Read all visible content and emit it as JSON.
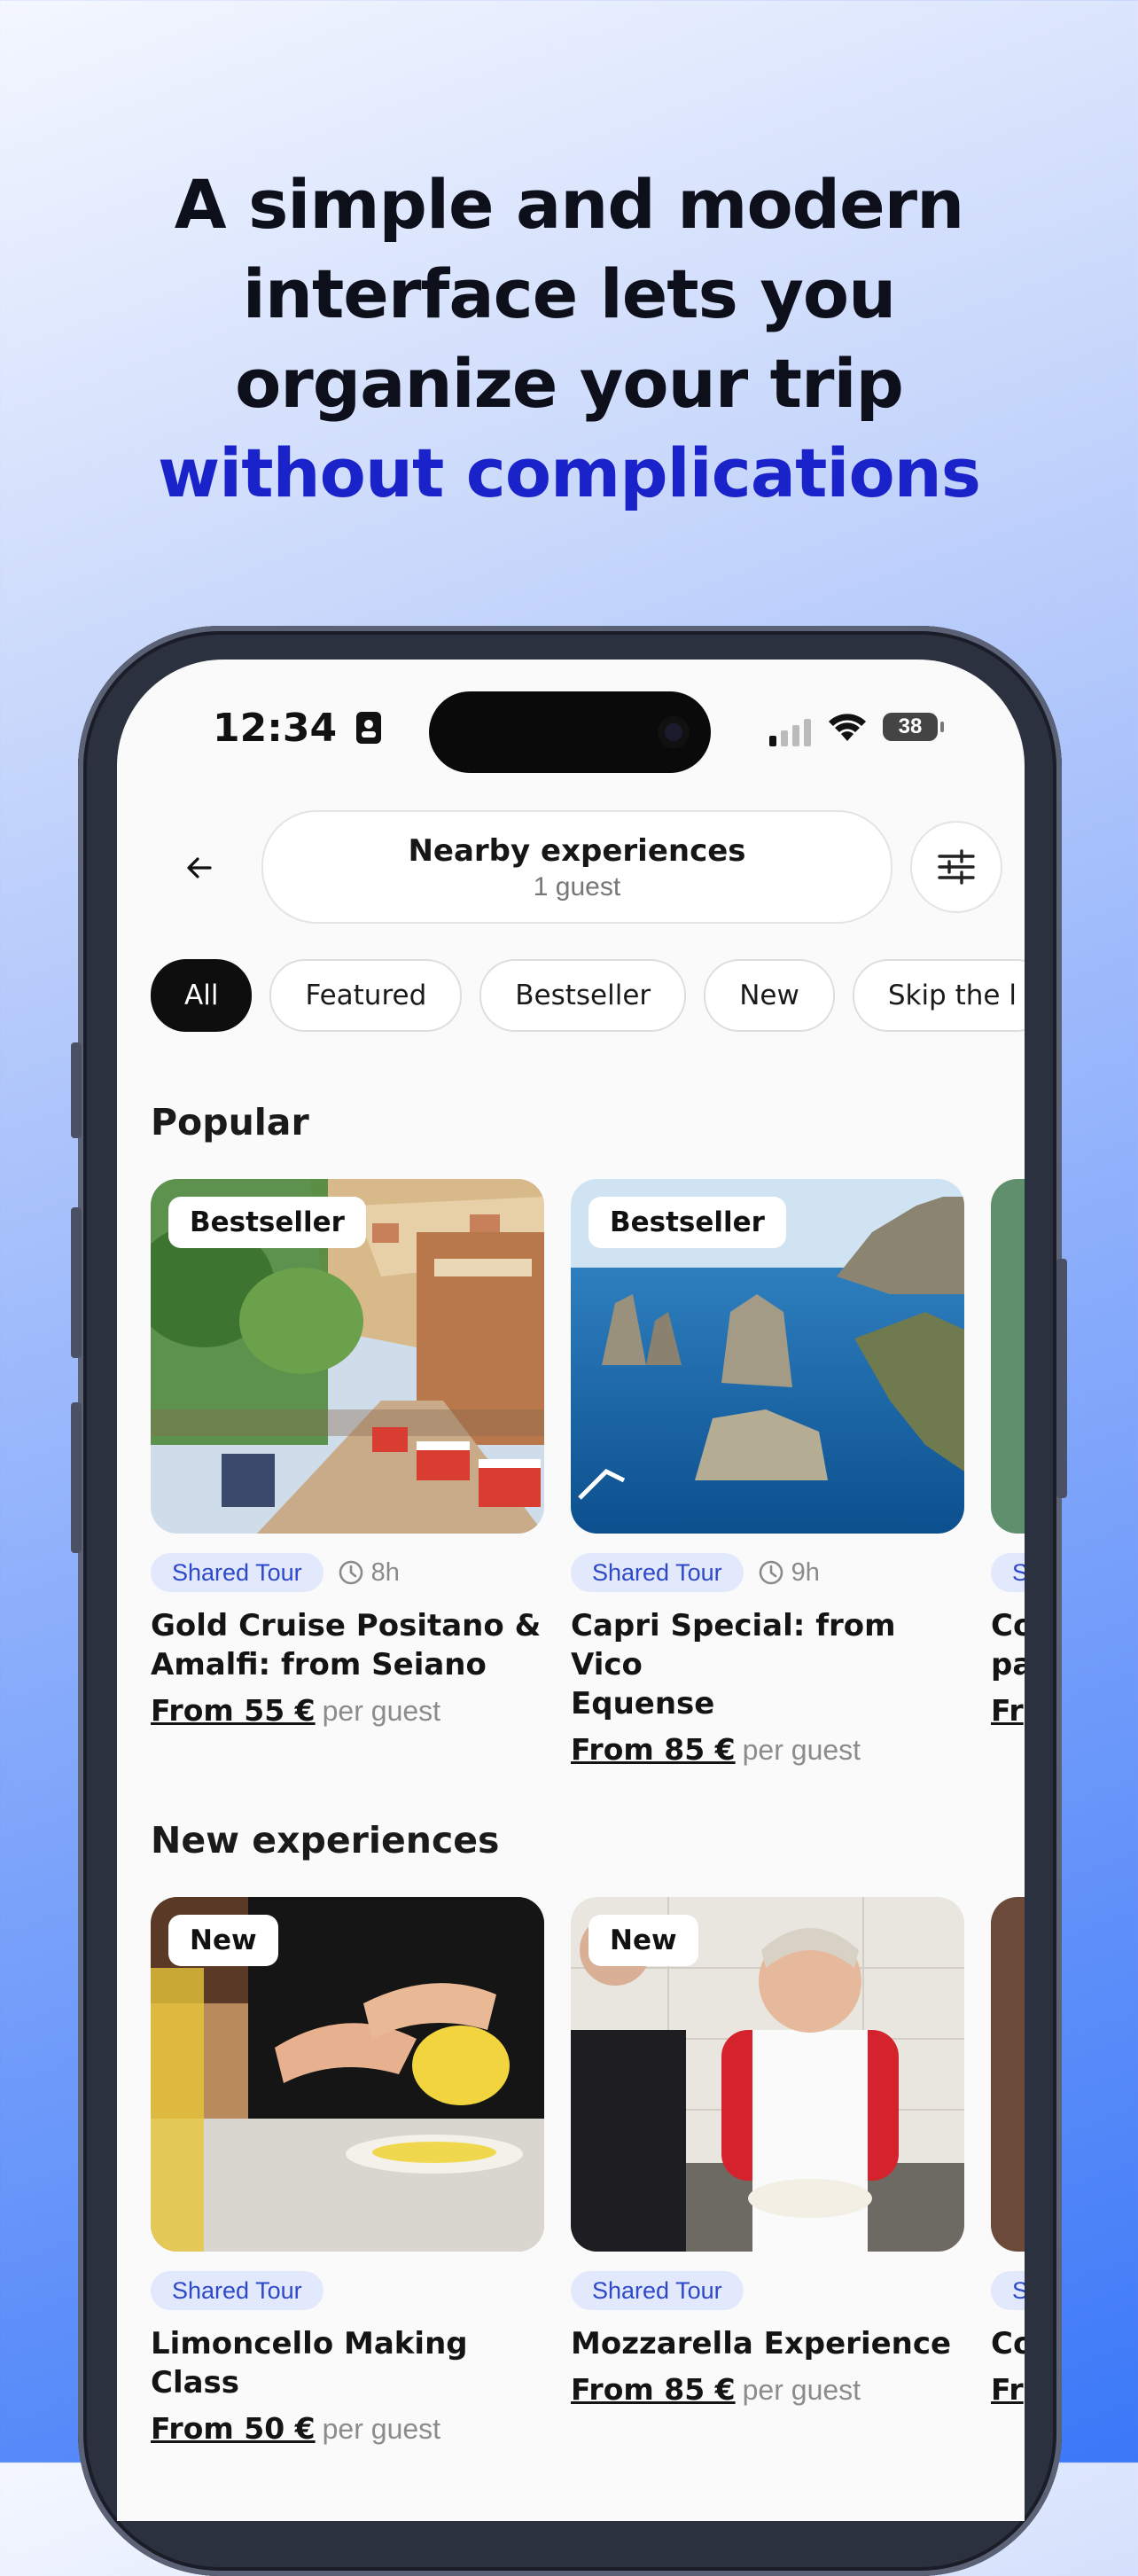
{
  "headline": {
    "line1": "A simple and modern",
    "line2": "interface lets you",
    "line3": "organize your trip",
    "accent": "without complications",
    "accent_color": "#1a23c9"
  },
  "status_bar": {
    "time": "12:34",
    "battery": "38"
  },
  "header": {
    "search_title": "Nearby experiences",
    "search_subtitle": "1 guest"
  },
  "chips": [
    {
      "label": "All",
      "active": true
    },
    {
      "label": "Featured",
      "active": false
    },
    {
      "label": "Bestseller",
      "active": false
    },
    {
      "label": "New",
      "active": false
    },
    {
      "label": "Skip the l",
      "active": false
    }
  ],
  "sections": {
    "popular": {
      "title": "Popular",
      "cards": [
        {
          "badge": "Bestseller",
          "tag": "Shared Tour",
          "duration": "8h",
          "title_line1": "Gold Cruise Positano &",
          "title_line2": "Amalfi: from Seiano",
          "price": "From 55 €",
          "per": "per guest"
        },
        {
          "badge": "Bestseller",
          "tag": "Shared Tour",
          "duration": "9h",
          "title_line1": "Capri Special: from Vico",
          "title_line2": "Equense",
          "price": "From 85 €",
          "per": "per guest"
        },
        {
          "tag": "S",
          "title_line1": "Co",
          "title_line2": "pa",
          "price": "Fr"
        }
      ]
    },
    "new": {
      "title": "New experiences",
      "cards": [
        {
          "badge": "New",
          "tag": "Shared Tour",
          "title_line1": "Limoncello Making Class",
          "price": "From 50 €",
          "per": "per guest"
        },
        {
          "badge": "New",
          "tag": "Shared Tour",
          "title_line1": "Mozzarella Experience",
          "price": "From 85 €",
          "per": "per guest"
        },
        {
          "tag": "S",
          "title_line1": "Co",
          "price": "Fr"
        }
      ]
    }
  }
}
